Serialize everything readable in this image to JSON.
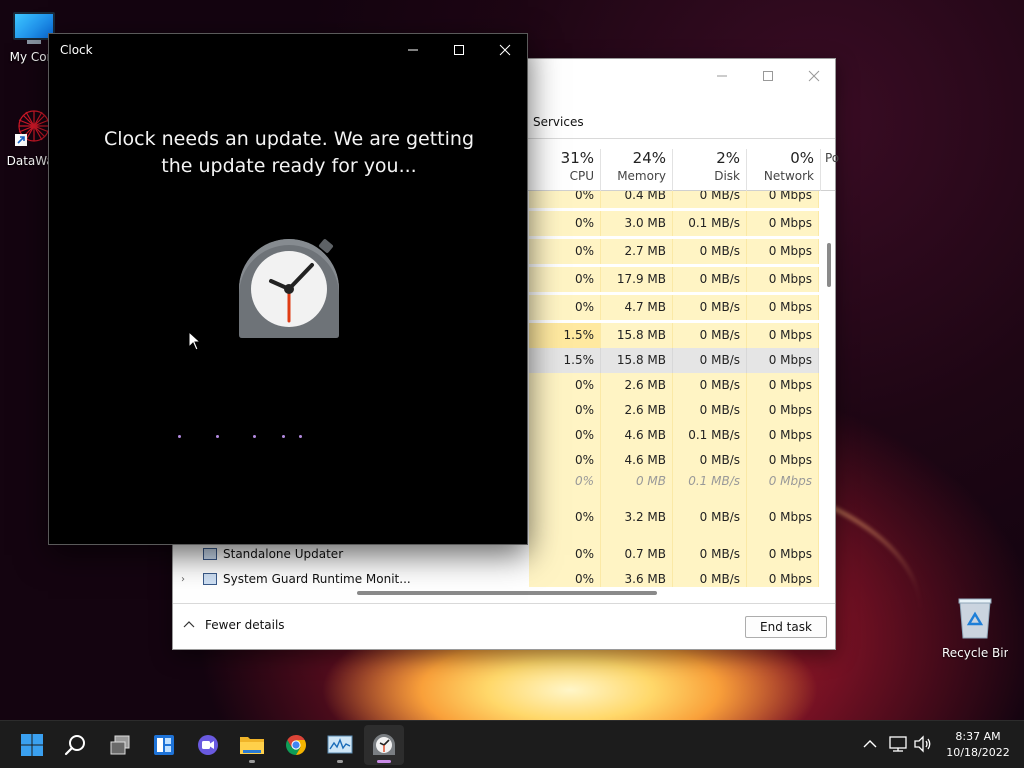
{
  "desktop": {
    "icons": [
      {
        "label": "My Com"
      },
      {
        "label": "DataWag"
      },
      {
        "label": "Recycle Bin"
      }
    ]
  },
  "clock_window": {
    "title": "Clock",
    "message": "Clock needs an update. We are getting the update ready for you...",
    "icon": "stopwatch-clock-icon"
  },
  "task_manager": {
    "tab_services": "Services",
    "columns": [
      {
        "percent": "31%",
        "name": "CPU"
      },
      {
        "percent": "24%",
        "name": "Memory"
      },
      {
        "percent": "2%",
        "name": "Disk"
      },
      {
        "percent": "0%",
        "name": "Network"
      },
      {
        "percent": "",
        "name": "Po"
      }
    ],
    "rows": [
      {
        "name": "",
        "cpu": "0%",
        "memory": "0.4 MB",
        "disk": "0 MB/s",
        "network": "0 Mbps"
      },
      {
        "name": "",
        "cpu": "0%",
        "memory": "3.0 MB",
        "disk": "0.1 MB/s",
        "network": "0 Mbps"
      },
      {
        "name": "",
        "cpu": "0%",
        "memory": "2.7 MB",
        "disk": "0 MB/s",
        "network": "0 Mbps"
      },
      {
        "name": "",
        "cpu": "0%",
        "memory": "17.9 MB",
        "disk": "0 MB/s",
        "network": "0 Mbps"
      },
      {
        "name": "",
        "cpu": "0%",
        "memory": "4.7 MB",
        "disk": "0 MB/s",
        "network": "0 Mbps"
      },
      {
        "name": "",
        "cpu": "1.5%",
        "memory": "15.8 MB",
        "disk": "0 MB/s",
        "network": "0 Mbps"
      },
      {
        "name": "",
        "cpu": "1.5%",
        "memory": "15.8 MB",
        "disk": "0 MB/s",
        "network": "0 Mbps"
      },
      {
        "name": "",
        "cpu": "0%",
        "memory": "2.6 MB",
        "disk": "0 MB/s",
        "network": "0 Mbps"
      },
      {
        "name": "",
        "cpu": "0%",
        "memory": "2.6 MB",
        "disk": "0 MB/s",
        "network": "0 Mbps"
      },
      {
        "name": "",
        "cpu": "0%",
        "memory": "4.6 MB",
        "disk": "0.1 MB/s",
        "network": "0 Mbps"
      },
      {
        "name": "",
        "cpu": "0%",
        "memory": "4.6 MB",
        "disk": "0 MB/s",
        "network": "0 Mbps"
      },
      {
        "name": "",
        "cpu": "0%",
        "memory": "0 MB",
        "disk": "0.1 MB/s",
        "network": "0 Mbps"
      },
      {
        "name": "",
        "cpu": "0%",
        "memory": "3.2 MB",
        "disk": "0 MB/s",
        "network": "0 Mbps"
      },
      {
        "name": "",
        "cpu": "",
        "memory": "",
        "disk": "",
        "network": ""
      },
      {
        "name": "Standalone Updater",
        "cpu": "0%",
        "memory": "0.7 MB",
        "disk": "0 MB/s",
        "network": "0 Mbps"
      },
      {
        "name": "System Guard Runtime Monit...",
        "cpu": "0%",
        "memory": "3.6 MB",
        "disk": "0 MB/s",
        "network": "0 Mbps"
      }
    ],
    "fewer_details": "Fewer details",
    "end_task": "End task"
  },
  "taskbar": {
    "apps": [
      "start",
      "search",
      "task-view",
      "widgets",
      "teams-chat",
      "file-explorer",
      "chrome",
      "task-manager",
      "clock"
    ],
    "time": "8:37 AM",
    "date": "10/18/2022"
  },
  "colors": {
    "taskbar_bg": "#1c1c1c",
    "active_indicator": "#c98be6",
    "heat_cell": "#fff4c4",
    "selected_row": "#e5e5e5"
  }
}
